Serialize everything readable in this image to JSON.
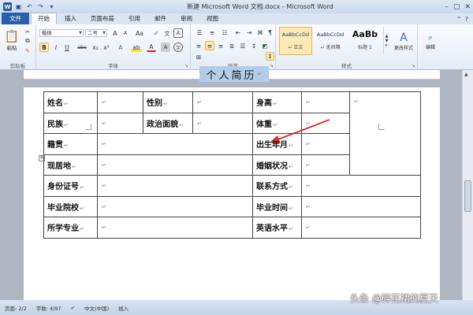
{
  "window": {
    "title": "新建 Microsoft Word 文档.docx - Microsoft Word"
  },
  "quick_access": {
    "app_icon": "W",
    "icons": [
      "save-icon",
      "undo-icon",
      "redo-icon",
      "customize-icon"
    ]
  },
  "tabs": [
    {
      "label": "文件"
    },
    {
      "label": "开始"
    },
    {
      "label": "插入"
    },
    {
      "label": "页面布局"
    },
    {
      "label": "引用"
    },
    {
      "label": "邮件"
    },
    {
      "label": "审阅"
    },
    {
      "label": "视图"
    }
  ],
  "ribbon": {
    "clipboard": {
      "label": "剪贴板",
      "paste_label": "粘贴"
    },
    "font": {
      "label": "字体",
      "font_name": "楷体",
      "font_size": "二号",
      "grow": "A",
      "shrink": "A",
      "case": "Aa",
      "bold": "B",
      "italic": "I",
      "underline": "U",
      "strike": "abc",
      "subscript": "x₂",
      "superscript": "x²",
      "color": "A"
    },
    "paragraph": {
      "label": "段落"
    },
    "styles": {
      "label": "样式",
      "items": [
        {
          "sample": "AaBbCcDd",
          "name": "↵ 正文"
        },
        {
          "sample": "AaBbCcDd",
          "name": "↵ 无间隔"
        },
        {
          "sample": "AaBb",
          "name": "标题 1"
        }
      ],
      "change_styles": "更改样式"
    },
    "editing": {
      "label": "编辑"
    }
  },
  "document": {
    "title": "个人简历",
    "end_mark": "↵",
    "table": {
      "rows": [
        [
          "姓名",
          "",
          "性别",
          "",
          "身高",
          "",
          ""
        ],
        [
          "民族",
          "",
          "政治面貌",
          "",
          "体重",
          ""
        ],
        [
          "籍贯",
          "",
          "出生年月",
          ""
        ],
        [
          "现居地",
          "",
          "婚姻状况",
          ""
        ],
        [
          "身份证号",
          "",
          "联系方式",
          ""
        ],
        [
          "毕业院校",
          "",
          "毕业时间",
          ""
        ],
        [
          "所学专业",
          "",
          "英语水平",
          ""
        ]
      ]
    }
  },
  "status": {
    "page": "页面: 2/2",
    "words": "字数: 4/97",
    "language": "中文(中国)",
    "mode": "插入"
  },
  "watermark": "头条 @碎花裙的夏天"
}
